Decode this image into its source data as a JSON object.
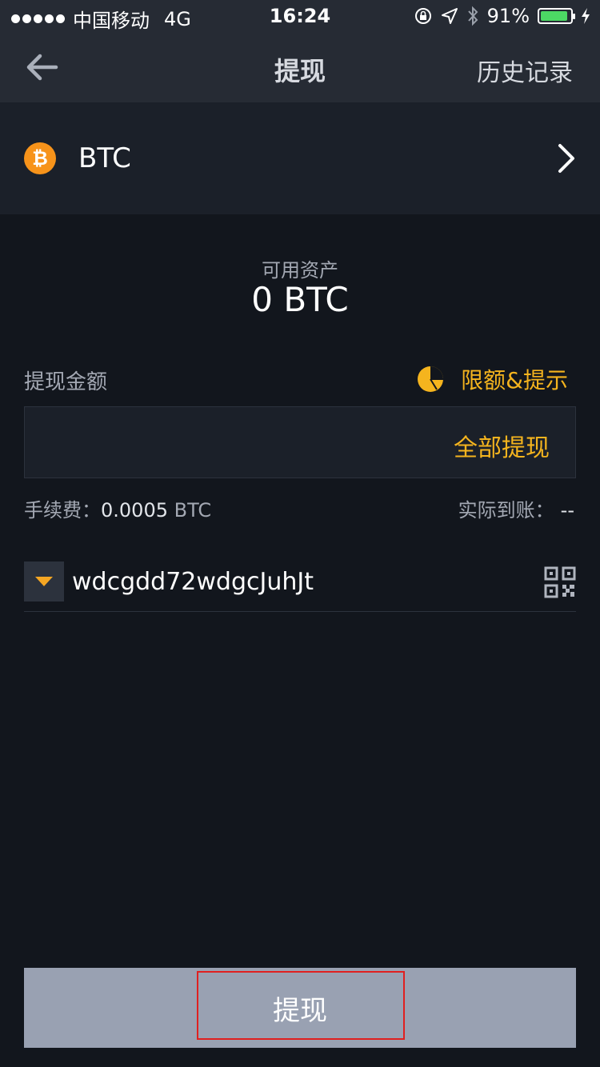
{
  "status_bar": {
    "carrier": "中国移动",
    "network": "4G",
    "time": "16:24",
    "battery": "91%",
    "battery_level": 0.91
  },
  "nav": {
    "title": "提现",
    "history": "历史记录"
  },
  "coin": {
    "name": "BTC",
    "icon": "bitcoin-icon"
  },
  "available": {
    "label": "可用资产",
    "value": "0 BTC"
  },
  "amount": {
    "label": "提现金额",
    "limit_text": "限额&提示",
    "withdraw_all": "全部提现",
    "fee_label": "手续费：",
    "fee_value": "0.0005",
    "fee_unit": " BTC",
    "actual_label": "实际到账：",
    "actual_value": "--"
  },
  "address": {
    "value": "wdcgdd72wdgcJuhJt"
  },
  "submit": {
    "label": "提现"
  },
  "colors": {
    "background": "#12161d",
    "panel": "#1b2029",
    "accent": "#f5b41e",
    "button": "#99a1b2",
    "highlight": "#e02020"
  }
}
